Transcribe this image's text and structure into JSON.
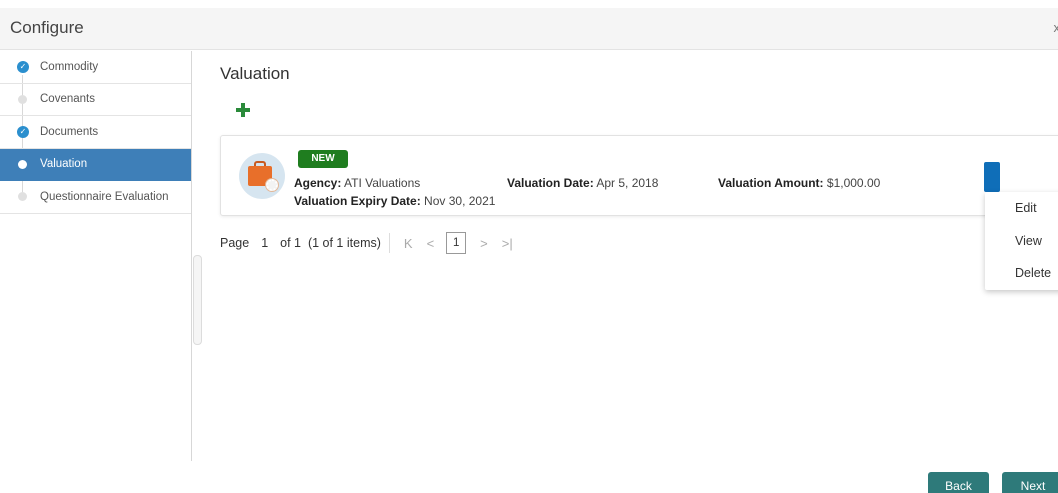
{
  "header": {
    "title": "Configure",
    "close_glyph": "x"
  },
  "sidebar": {
    "steps": [
      {
        "label": "Commodity",
        "state": "completed"
      },
      {
        "label": "Covenants",
        "state": "pending"
      },
      {
        "label": "Documents",
        "state": "completed"
      },
      {
        "label": "Valuation",
        "state": "active"
      },
      {
        "label": "Questionnaire Evaluation",
        "state": "pending"
      }
    ]
  },
  "main": {
    "title": "Valuation",
    "add_icon": "plus-icon",
    "card": {
      "badge": "NEW",
      "agency_label": "Agency:",
      "agency_value": "ATI Valuations",
      "valuation_date_label": "Valuation Date:",
      "valuation_date_value": "Apr 5, 2018",
      "valuation_amount_label": "Valuation Amount:",
      "valuation_amount_value": "$1,000.00",
      "expiry_label": "Valuation Expiry Date:",
      "expiry_value": "Nov 30, 2021",
      "avatar_icon": "briefcase-gear-icon"
    },
    "menu": {
      "items": [
        "Edit",
        "View",
        "Delete"
      ]
    },
    "pager": {
      "page_label": "Page",
      "page_number": "1",
      "of_text": "of 1  (1 of 1 items)",
      "first_glyph": "K",
      "prev_glyph": "<",
      "current": "1",
      "next_glyph": ">",
      "last_glyph": ">|"
    }
  },
  "footer": {
    "back_label": "Back",
    "next_label": "Next"
  },
  "colors": {
    "accent": "#3e7fb8",
    "badge": "#1f7d1f",
    "button": "#2e7a7a",
    "menu_button": "#0f6eb8"
  }
}
